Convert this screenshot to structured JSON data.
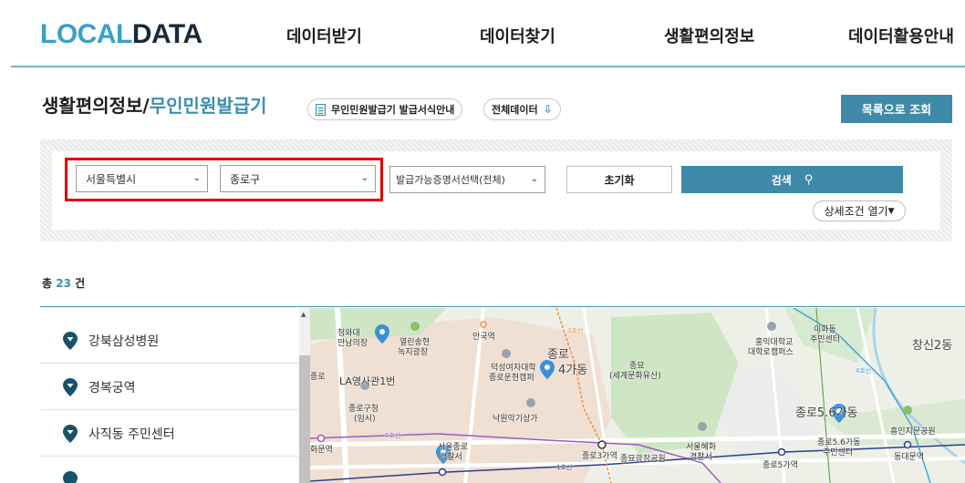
{
  "header": {
    "logo_part1": "LOCAL",
    "logo_part2": "DATA",
    "nav": [
      "데이터받기",
      "데이터찾기",
      "생활편의정보",
      "데이터활용안내"
    ]
  },
  "title": {
    "category": "생활편의정보/",
    "name": "무인민원발급기",
    "form_guide": "무인민원발급기 발급서식안내",
    "all_data": "전체데이터",
    "list_view": "목록으로 조회"
  },
  "search": {
    "city": "서울특별시",
    "district": "종로구",
    "cert_select": "발급가능증명서선택(전체)",
    "reset": "초기화",
    "search": "검색",
    "detail": "상세조건 열기"
  },
  "count": {
    "prefix": "총",
    "value": "23",
    "suffix": "건"
  },
  "results": [
    "강북삼성병원",
    "경복궁역",
    "사직동 주민센터"
  ],
  "map": {
    "labels": [
      "청와대",
      "만남의장",
      "열린송현",
      "녹지광장",
      "안국역",
      "종로",
      "4가동",
      "덕성여자대학",
      "종로운현캠퍼",
      "종묘",
      "(세계문화유산)",
      "홍익대학교",
      "대학로캠퍼스",
      "이화동",
      "주민센터",
      "창신2동",
      "LA영사관1번",
      "종로구청",
      "(임시)",
      "낙원악기상가",
      "서울종로",
      "경찰서",
      "종로3가역",
      "종묘광장공원",
      "서울혜화",
      "경찰서",
      "종로5.6가동",
      "종로5.6가동",
      "주민센터",
      "종로5가역",
      "흥인지문공원",
      "동대문역",
      "화문역",
      "5호선",
      "1호선",
      "3호선",
      "4호선",
      "종로"
    ],
    "colors": {
      "park": "#cfe6c4",
      "urban": "#f0ddd0",
      "water": "#a8d4ea",
      "line5": "#9a5cc6",
      "line1": "#2a3f8f",
      "line3": "#ef8a3c",
      "line4": "#43a6d8",
      "marker": "#3b8fd6"
    }
  },
  "colors": {
    "accent": "#3f8aa8",
    "highlight": "#e00000",
    "pin": "#17526a"
  }
}
